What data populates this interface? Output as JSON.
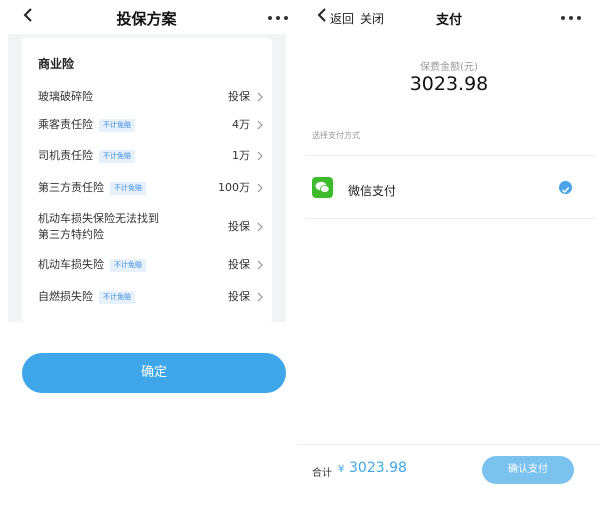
{
  "left": {
    "title": "投保方案",
    "section_title": "商业险",
    "rows": [
      {
        "label": "玻璃破碎险",
        "tag": "",
        "value": "投保"
      },
      {
        "label": "乘客责任险",
        "tag": "不计免赔",
        "value": "4万"
      },
      {
        "label": "司机责任险",
        "tag": "不计免赔",
        "value": "1万"
      },
      {
        "label": "第三方责任险",
        "tag": "不计免赔",
        "value": "100万"
      },
      {
        "label": "机动车损失保险无法找到",
        "label2": "第三方特约险",
        "tag": "",
        "value": "投保"
      },
      {
        "label": "机动车损失险",
        "tag": "不计免赔",
        "value": "投保"
      },
      {
        "label": "自燃损失险",
        "tag": "不计免赔",
        "value": "投保"
      }
    ],
    "confirm_label": "确定"
  },
  "right": {
    "back_label": "返回",
    "close_label": "关闭",
    "title": "支付",
    "amount_label": "保费金额(元)",
    "amount": "3023.98",
    "pay_method_label": "选择支付方式",
    "wechat_label": "微信支付",
    "total_label": "合计",
    "total_currency": "¥",
    "total_amount": "3023.98",
    "pay_button_label": "确认支付"
  },
  "colors": {
    "accent": "#3fa6ea",
    "wechat_green": "#3dbb2c",
    "tag_text": "#3a8be0"
  }
}
